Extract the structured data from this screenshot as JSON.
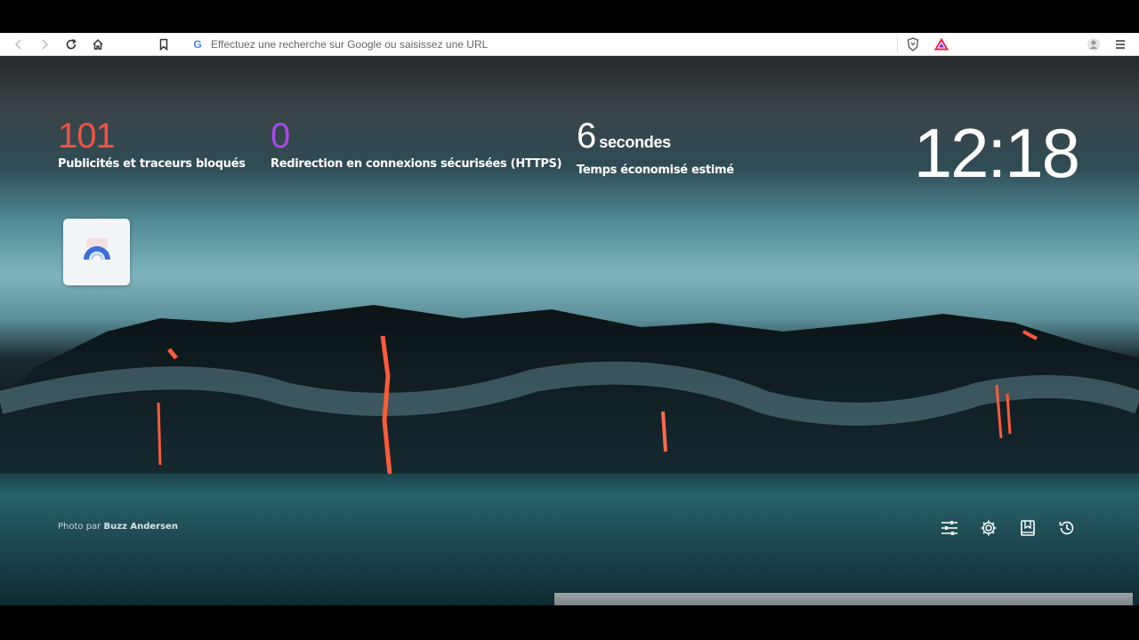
{
  "browser": {
    "address_placeholder": "Effectuez une recherche sur Google ou saisissez une URL",
    "search_engine_letter": "G"
  },
  "stats": [
    {
      "value": "101",
      "label": "Publicités et traceurs bloqués",
      "color": "#f0533f"
    },
    {
      "value": "0",
      "label": "Redirection en connexions sécurisées (HTTPS)",
      "color": "#a74ae6"
    },
    {
      "value": "6",
      "unit": "secondes",
      "label": "Temps économisé estimé",
      "color": "#ffffff"
    }
  ],
  "clock": {
    "time": "12:18"
  },
  "photo_credit": {
    "prefix": "Photo par",
    "author": "Buzz Andersen"
  },
  "icons": {
    "back": "back-arrow-icon",
    "forward": "forward-arrow-icon",
    "reload": "reload-icon",
    "home": "home-icon",
    "bookmark": "bookmark-icon",
    "shields": "brave-shield-icon",
    "rewards": "brave-rewards-icon",
    "profile": "profile-icon",
    "menu": "menu-icon",
    "customize": "sliders-icon",
    "settings": "gear-icon",
    "bookmarks": "bookmarks-icon",
    "history": "history-icon"
  },
  "colors": {
    "brave_orange": "#fb542b",
    "rewards_red": "#e0294c",
    "rewards_purple": "#8a2be2"
  }
}
